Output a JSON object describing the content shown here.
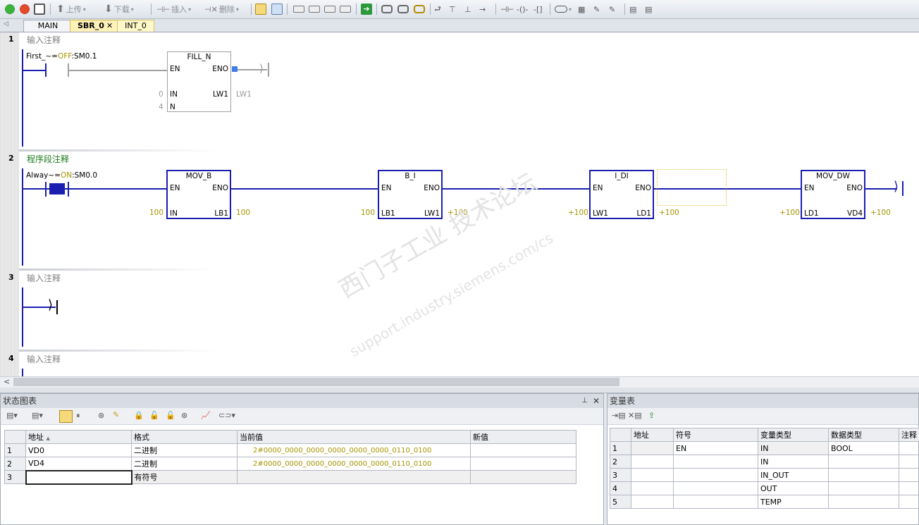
{
  "toolbar": {
    "upload_label": "上传",
    "download_label": "下载",
    "insert_label": "插入",
    "delete_label": "删除"
  },
  "tabs": [
    "MAIN",
    "SBR_0",
    "INT_0"
  ],
  "networks": [
    {
      "number": "1",
      "comment": "输入注释"
    },
    {
      "number": "2",
      "comment": "程序段注释"
    },
    {
      "number": "3",
      "comment": "输入注释"
    },
    {
      "number": "4",
      "comment": "输入注释"
    }
  ],
  "net1": {
    "contact_sym": "First_~",
    "contact_eq": "=",
    "contact_state": "OFF",
    "contact_addr": ":SM0.1",
    "box_title": "FILL_N",
    "pin_en": "EN",
    "pin_eno": "ENO",
    "pin_in": "IN",
    "pin_n": "N",
    "pin_out": "LW1",
    "in_val": "0",
    "n_val": "4",
    "out_val": "LW1"
  },
  "net2": {
    "contact_sym": "Alway~",
    "contact_eq": "=",
    "contact_state": "ON",
    "contact_addr": ":SM0.0",
    "boxes": [
      {
        "title": "MOV_B",
        "in_pin": "IN",
        "out_pin": "LB1",
        "in_val": "100",
        "out_val": "100"
      },
      {
        "title": "B_I",
        "in_pin": "LB1",
        "out_pin": "LW1",
        "in_val": "100",
        "out_val": "+100"
      },
      {
        "title": "I_DI",
        "in_pin": "LW1",
        "out_pin": "LD1",
        "in_val": "+100",
        "out_val": "+100"
      },
      {
        "title": "MOV_DW",
        "in_pin": "LD1",
        "out_pin": "VD4",
        "in_val": "+100",
        "out_val": "+100"
      }
    ],
    "pin_en": "EN",
    "pin_eno": "ENO"
  },
  "watermark": {
    "line1": "西门子工业 技术论坛",
    "line2": "support.industry.siemens.com/cs"
  },
  "status_chart": {
    "title": "状态图表",
    "columns": [
      "地址",
      "格式",
      "当前值",
      "新值"
    ],
    "rows": [
      {
        "n": "1",
        "addr": "VD0",
        "fmt": "二进制",
        "cur": "2#0000_0000_0000_0000_0000_0000_0110_0100",
        "new": ""
      },
      {
        "n": "2",
        "addr": "VD4",
        "fmt": "二进制",
        "cur": "2#0000_0000_0000_0000_0000_0000_0110_0100",
        "new": ""
      },
      {
        "n": "3",
        "addr": "",
        "fmt": "有符号",
        "cur": "",
        "new": ""
      }
    ]
  },
  "var_table": {
    "title": "变量表",
    "columns": [
      "地址",
      "符号",
      "变量类型",
      "数据类型",
      "注释"
    ],
    "rows": [
      {
        "n": "1",
        "addr": "",
        "sym": "EN",
        "vtype": "IN",
        "dtype": "BOOL",
        "cmt": ""
      },
      {
        "n": "2",
        "addr": "",
        "sym": "",
        "vtype": "IN",
        "dtype": "",
        "cmt": ""
      },
      {
        "n": "3",
        "addr": "",
        "sym": "",
        "vtype": "IN_OUT",
        "dtype": "",
        "cmt": ""
      },
      {
        "n": "4",
        "addr": "",
        "sym": "",
        "vtype": "OUT",
        "dtype": "",
        "cmt": ""
      },
      {
        "n": "5",
        "addr": "",
        "sym": "",
        "vtype": "TEMP",
        "dtype": "",
        "cmt": ""
      }
    ]
  },
  "colors": {
    "rail": "#1b1fb0",
    "value": "#a59300",
    "comment_green": "#1a7a1a"
  }
}
